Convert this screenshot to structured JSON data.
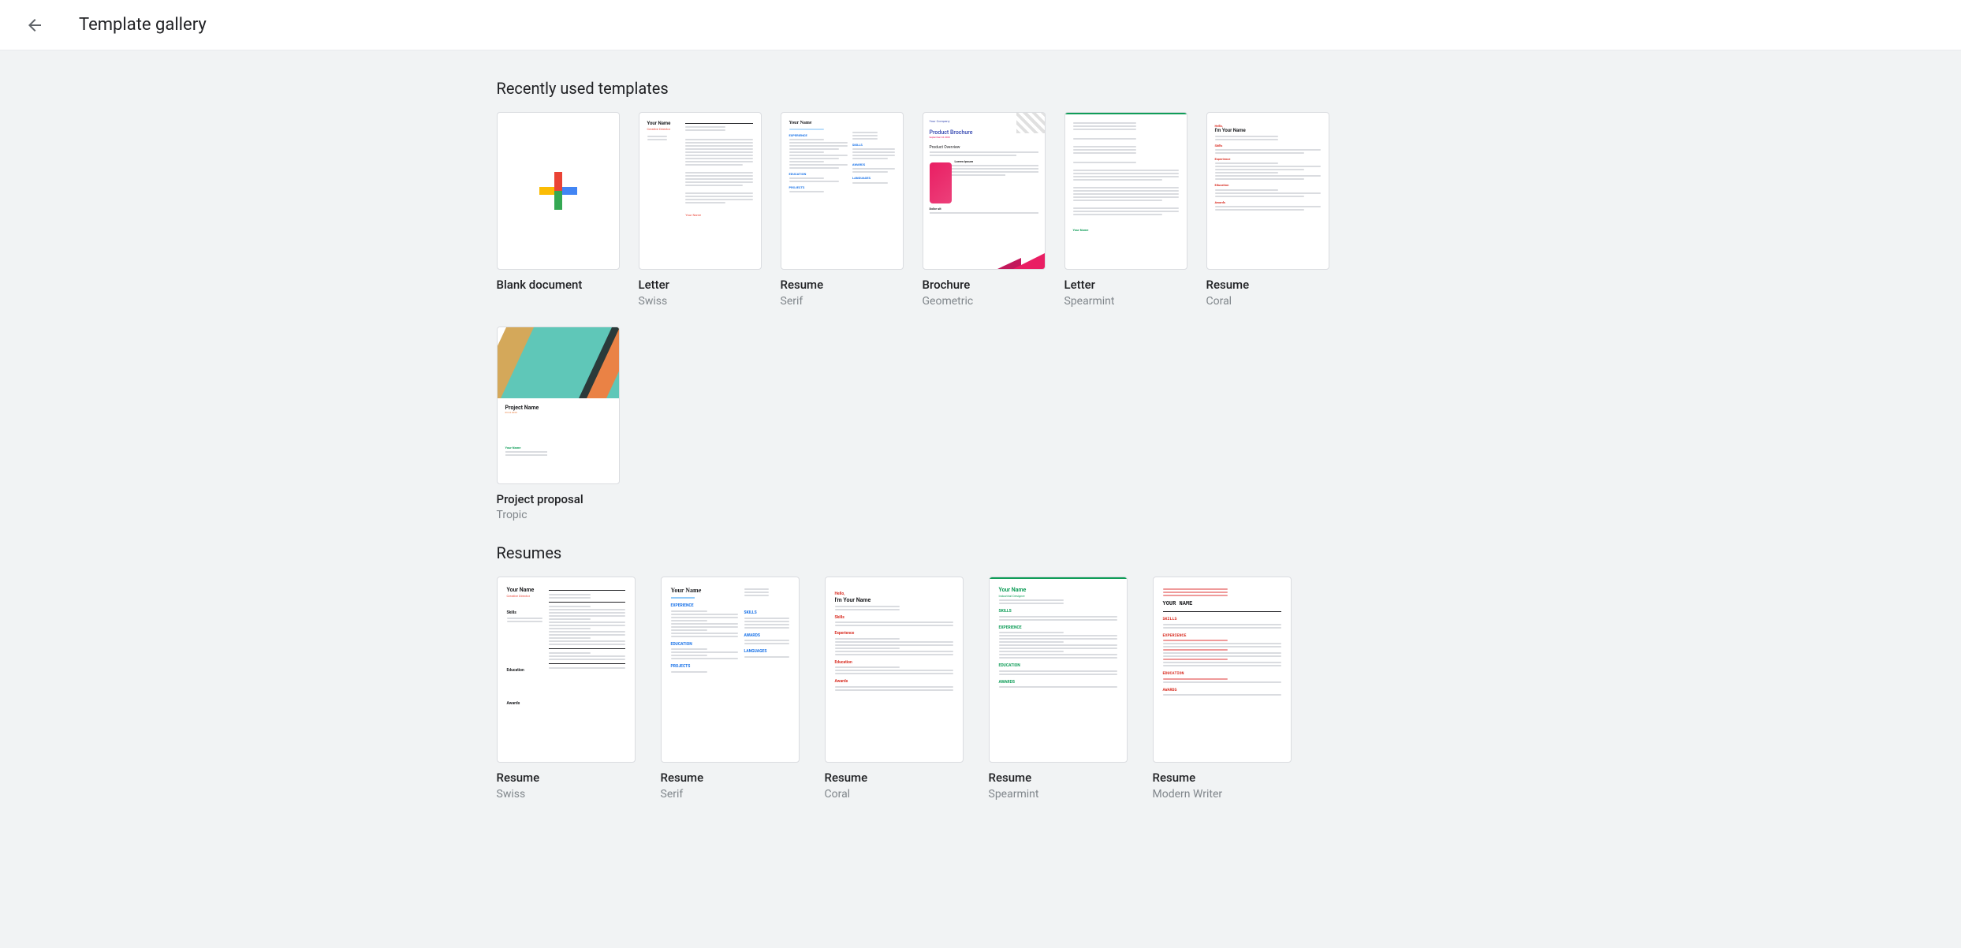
{
  "header": {
    "title": "Template gallery"
  },
  "sections": {
    "recent": {
      "title": "Recently used templates",
      "items": [
        {
          "title": "Blank document",
          "subtitle": ""
        },
        {
          "title": "Letter",
          "subtitle": "Swiss"
        },
        {
          "title": "Resume",
          "subtitle": "Serif"
        },
        {
          "title": "Brochure",
          "subtitle": "Geometric"
        },
        {
          "title": "Letter",
          "subtitle": "Spearmint"
        },
        {
          "title": "Resume",
          "subtitle": "Coral"
        },
        {
          "title": "Project proposal",
          "subtitle": "Tropic"
        }
      ]
    },
    "resumes": {
      "title": "Resumes",
      "items": [
        {
          "title": "Resume",
          "subtitle": "Swiss"
        },
        {
          "title": "Resume",
          "subtitle": "Serif"
        },
        {
          "title": "Resume",
          "subtitle": "Coral"
        },
        {
          "title": "Resume",
          "subtitle": "Spearmint"
        },
        {
          "title": "Resume",
          "subtitle": "Modern Writer"
        }
      ]
    }
  },
  "preview": {
    "your_name": "Your Name",
    "your_name_caps": "YOUR NAME",
    "creative_director": "Creative Director",
    "industrial_designer": "Industrial Designer",
    "hello": "Hello,",
    "im": "I'm Your Name",
    "product_brochure": "Product Brochure",
    "product_overview": "Product Overview",
    "lorem": "Lorem ipsum",
    "dolor": "Dolor sit",
    "project_name": "Project Name",
    "your_company": "Your Company",
    "skills": "Skills",
    "skills_caps": "SKILLS",
    "experience": "Experience",
    "experience_caps": "EXPERIENCE",
    "education": "Education",
    "education_caps": "EDUCATION",
    "awards": "Awards",
    "awards_caps": "AWARDS",
    "projects": "PROJECTS"
  }
}
